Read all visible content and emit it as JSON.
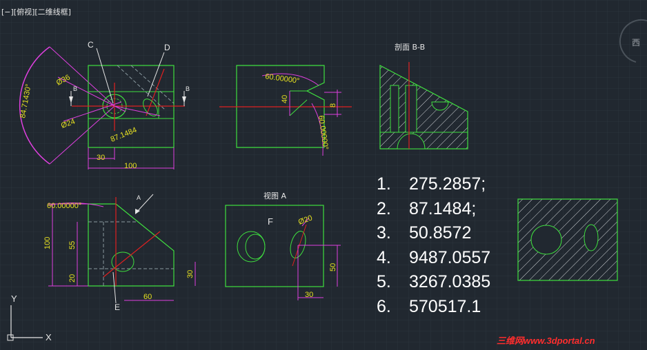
{
  "viewport": {
    "label": "[−][俯视][二维线框]"
  },
  "viewcube": {
    "label": "西"
  },
  "ucs": {
    "y_label": "Y",
    "x_label": "X"
  },
  "drawing": {
    "top_view": {
      "callout_c": "C",
      "callout_d": "D",
      "arc_angle": "84.71430°",
      "dia_outer": "Ø36",
      "dia_inner": "Ø24",
      "radius_dim": "87.1484",
      "dim_30": "30",
      "dim_100": "100",
      "section_b_left": "B",
      "section_b_right": "B"
    },
    "side_view": {
      "angle_top": "60.00000°",
      "angle_bottom": "60.00000°",
      "dim_40": "40",
      "dim_8": "8"
    },
    "section_bb": {
      "title": "剖面 B-B"
    },
    "front_view": {
      "angle": "60.00000°",
      "arrow_a": "A",
      "dim_100": "100",
      "dim_55": "55",
      "dim_20": "20",
      "dim_30": "30",
      "dim_60": "60",
      "callout_e": "E"
    },
    "view_a": {
      "title": "视图 A",
      "label_f": "F",
      "dia_20": "Ø20",
      "dim_50": "50",
      "dim_30": "30"
    }
  },
  "answers": [
    {
      "num": "1.",
      "value": "275.2857;"
    },
    {
      "num": "2.",
      "value": "87.1484;"
    },
    {
      "num": "3.",
      "value": "50.8572"
    },
    {
      "num": "4.",
      "value": "9487.0557"
    },
    {
      "num": "5.",
      "value": "3267.0385"
    },
    {
      "num": "6.",
      "value": "570517.1"
    }
  ],
  "watermark": "三维网www.3dportal.cn",
  "colors": {
    "background": "#212830",
    "outline": "#3fe03f",
    "center": "#e02020",
    "dimension": "#e040e0",
    "text": "#e6e020",
    "hatch": "#d8d8d8"
  }
}
